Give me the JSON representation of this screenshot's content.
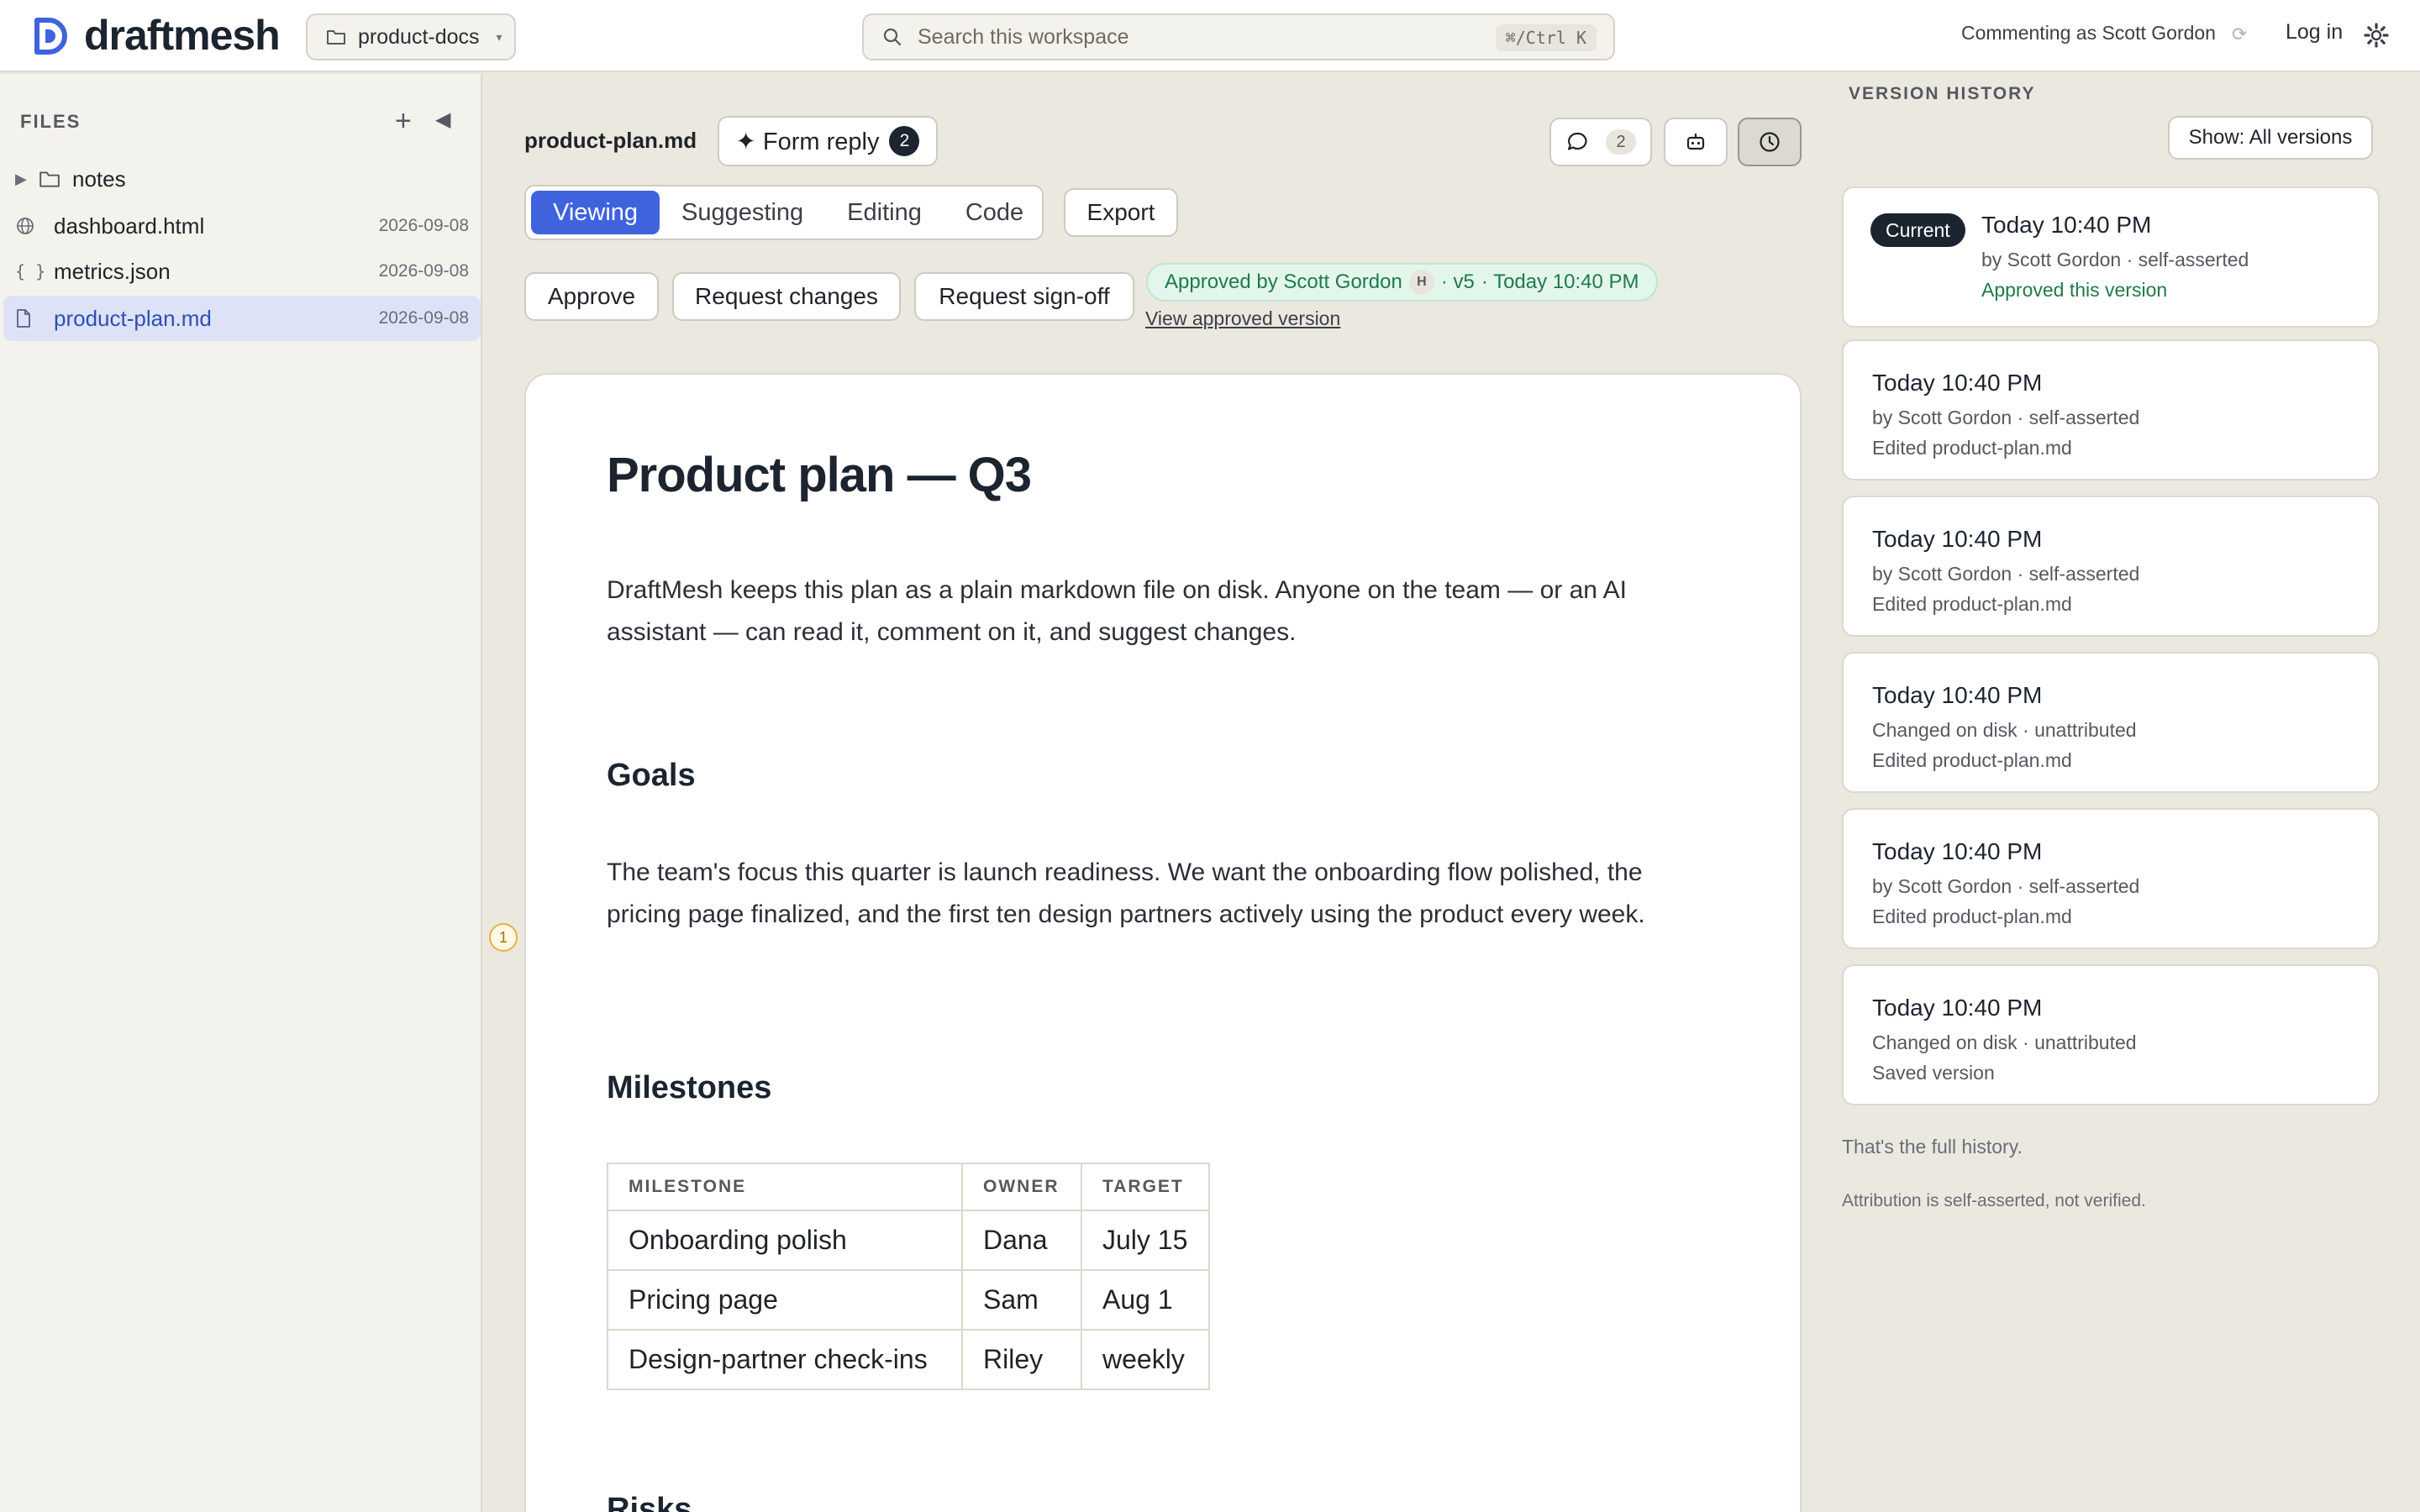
{
  "app": {
    "logo_text": "draftmesh",
    "workspace": "product-docs",
    "search_placeholder": "Search this workspace",
    "search_shortcut": "⌘/Ctrl K",
    "commenting_as": "Commenting as Scott Gordon",
    "login_label": "Log in",
    "brand_color": "#3f63dd"
  },
  "sidebar": {
    "label": "FILES",
    "add_icon": "plus-icon",
    "collapse_icon": "collapse-left-icon",
    "items": [
      {
        "name": "notes",
        "type": "folder",
        "date": ""
      },
      {
        "name": "dashboard.html",
        "type": "web",
        "date": "2026-09-08"
      },
      {
        "name": "metrics.json",
        "type": "json",
        "date": "2026-09-08"
      },
      {
        "name": "product-plan.md",
        "type": "doc",
        "date": "2026-09-08",
        "active": true
      }
    ]
  },
  "editor": {
    "filename": "product-plan.md",
    "form_reply_label": "✦ Form reply",
    "form_reply_count": "2",
    "comment_count": "2",
    "tabs": [
      "Viewing",
      "Suggesting",
      "Editing",
      "Code"
    ],
    "active_tab": "Viewing",
    "export_label": "Export",
    "review_actions": [
      "Approve",
      "Request changes",
      "Request sign-off"
    ],
    "approval": {
      "text": "Approved by Scott Gordon",
      "initial": "H",
      "version": "· v5",
      "time": "· Today 10:40 PM",
      "link": "View approved version"
    }
  },
  "document": {
    "title": "Product plan — Q3",
    "intro": "DraftMesh keeps this plan as a plain markdown file on disk. Anyone on the team — or an AI assistant — can read it, comment on it, and suggest changes.",
    "goals_heading": "Goals",
    "goals_text": "The team's focus this quarter is launch readiness. We want the onboarding flow polished, the pricing page finalized, and the first ten design partners actively using the product every week.",
    "comment_marker": "1",
    "milestones_heading": "Milestones",
    "table": {
      "headers": [
        "MILESTONE",
        "OWNER",
        "TARGET"
      ],
      "rows": [
        [
          "Onboarding polish",
          "Dana",
          "July 15"
        ],
        [
          "Pricing page",
          "Sam",
          "Aug 1"
        ],
        [
          "Design-partner check-ins",
          "Riley",
          "weekly"
        ]
      ]
    },
    "risks_heading": "Risks"
  },
  "history": {
    "label": "VERSION HISTORY",
    "filter_label": "Show: All versions",
    "versions": [
      {
        "current": "Current",
        "time": "Today 10:40 PM",
        "by": "by Scott Gordon · self-asserted",
        "action": "Approved this version"
      },
      {
        "time": "Today 10:40 PM",
        "by": "by Scott Gordon · self-asserted",
        "action": "Edited product-plan.md"
      },
      {
        "time": "Today 10:40 PM",
        "by": "by Scott Gordon · self-asserted",
        "action": "Edited product-plan.md"
      },
      {
        "time": "Today 10:40 PM",
        "by": "Changed on disk · unattributed",
        "action": "Edited product-plan.md"
      },
      {
        "time": "Today 10:40 PM",
        "by": "by Scott Gordon · self-asserted",
        "action": "Edited product-plan.md"
      },
      {
        "time": "Today 10:40 PM",
        "by": "Changed on disk · unattributed",
        "action": "Saved version"
      }
    ],
    "end_note": "That's the full history.",
    "attribution_note": "Attribution is self-asserted, not verified."
  }
}
